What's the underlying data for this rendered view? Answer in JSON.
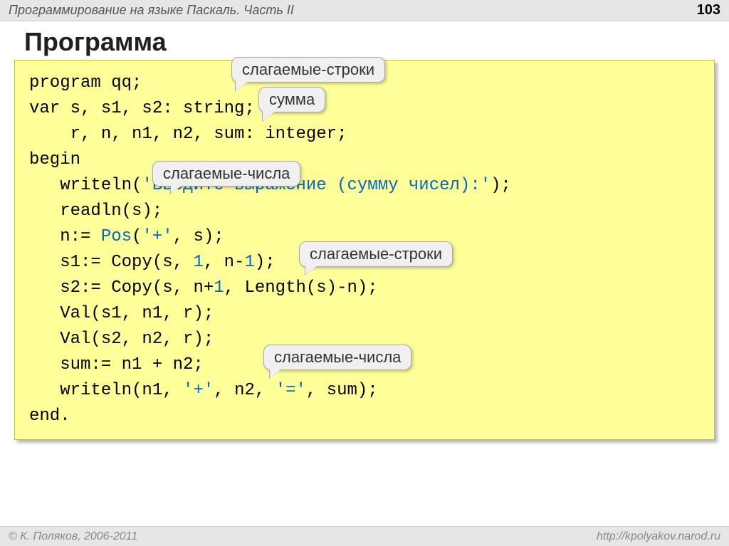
{
  "header": {
    "title": "Программирование на языке Паскаль. Часть II",
    "page": "103"
  },
  "slide": {
    "title": "Программа"
  },
  "code": {
    "l1": "program qq;",
    "l2": "var s, s1, s2: string;",
    "l3": "    r, n, n1, n2, sum: integer;",
    "l4": "begin",
    "l5a": "   writeln(",
    "l5b": "'Введите выражение (сумму чисел):'",
    "l5c": ");",
    "l6": "   readln(s);",
    "l7a": "   n:= ",
    "l7b": "Pos",
    "l7c": "(",
    "l7d": "'+'",
    "l7e": ", s);",
    "l8a": "   s1:= Copy(s, ",
    "l8b": "1",
    "l8c": ", n-",
    "l8d": "1",
    "l8e": ");",
    "l9a": "   s2:= Copy(s, n+",
    "l9b": "1",
    "l9c": ", Length(s)-n);",
    "l10": "   Val(s1, n1, r);",
    "l11": "   Val(s2, n2, r);",
    "l12": "   sum:= n1 + n2;",
    "l13a": "   writeln(n1, ",
    "l13b": "'+'",
    "l13c": ", n2, ",
    "l13d": "'='",
    "l13e": ", sum);",
    "l14": "end."
  },
  "callouts": {
    "c1": "слагаемые-строки",
    "c2": "сумма",
    "c3": "слагаемые-числа",
    "c4": "слагаемые-строки",
    "c5": "слагаемые-числа"
  },
  "footer": {
    "left": "© К. Поляков, 2006-2011",
    "right": "http://kpolyakov.narod.ru"
  }
}
